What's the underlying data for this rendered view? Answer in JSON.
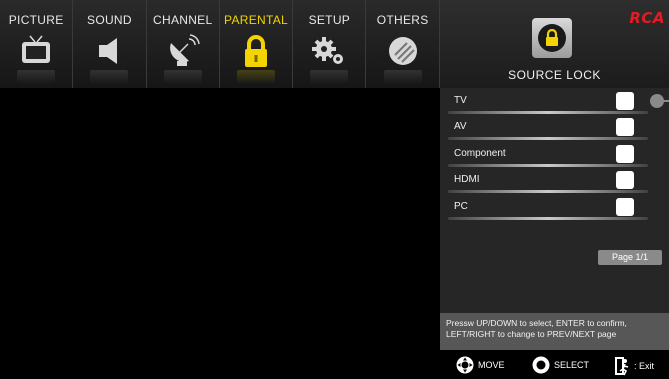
{
  "tabs": [
    {
      "label": "PICTURE",
      "icon": "tv-icon"
    },
    {
      "label": "SOUND",
      "icon": "speaker-icon"
    },
    {
      "label": "CHANNEL",
      "icon": "satellite-dish-icon"
    },
    {
      "label": "PARENTAL",
      "icon": "lock-icon"
    },
    {
      "label": "SETUP",
      "icon": "gears-icon"
    },
    {
      "label": "OTHERS",
      "icon": "others-icon"
    }
  ],
  "active_tab": "PARENTAL",
  "brand_logo": "RCA",
  "section": {
    "title": "SOURCE LOCK",
    "icon": "lock-icon"
  },
  "sources": [
    {
      "label": "TV",
      "checked": false
    },
    {
      "label": "AV",
      "checked": false
    },
    {
      "label": "Component",
      "checked": false
    },
    {
      "label": "HDMI",
      "checked": false
    },
    {
      "label": "PC",
      "checked": false
    }
  ],
  "page_indicator": "Page 1/1",
  "help_text": "Pressw UP/DOWN to select, ENTER to confirm, LEFT/RIGHT to change to PREV/NEXT page",
  "footer": {
    "move_label": "MOVE",
    "select_label": "SELECT",
    "exit_label": ": Exit"
  },
  "colors": {
    "active_tab": "#f3d400",
    "brand": "#e31b23",
    "panel_bg": "#262626"
  }
}
